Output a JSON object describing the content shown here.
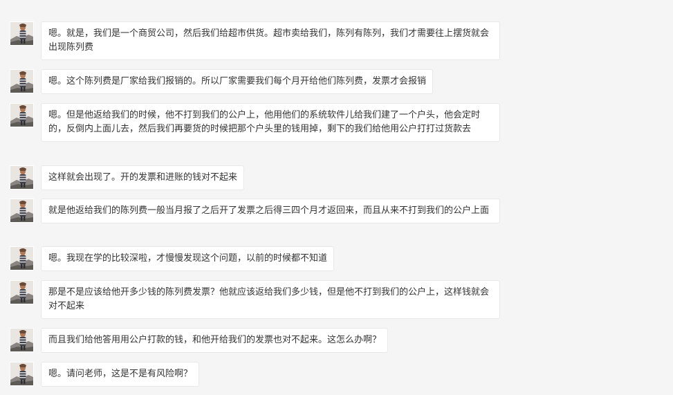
{
  "messages": [
    {
      "text": "嗯。就是，我们是一个商贸公司，然后我们给超市供货。超市卖给我们，陈列有陈列，我们才需要往上摆货就会出现陈列费"
    },
    {
      "text": "嗯。这个陈列费是厂家给我们报销的。所以厂家需要我们每个月开给他们陈列费，发票才会报销"
    },
    {
      "text": "嗯。但是他返给我们的时候，他不打到我们的公户上，他用他们的系统软件儿给我们建了一个户头，他会定时的，反倒内上面儿去，然后我们再要货的时候把那个户头里的钱用掉，剩下的我们给他用公户打打过货款去"
    },
    {
      "text": "这样就会出现了。开的发票和进账的钱对不起来"
    },
    {
      "text": "就是他返给我们的陈列费一般当月报了之后开了发票之后得三四个月才返回来，而且从来不打到我们的公户上面"
    },
    {
      "text": "嗯。我现在学的比较深啦，才慢慢发现这个问题，以前的时候都不知道"
    },
    {
      "text": "那是不是应该给他开多少钱的陈列费发票？他就应该返给我们多少钱，但是他不打到我们的公户上，这样钱就会对不起来"
    },
    {
      "text": "而且我们给他答用用公户打款的钱，和他开给我们的发票也对不起来。这怎么办啊？"
    },
    {
      "text": "嗯。请问老师，这是不是有风险啊？"
    }
  ]
}
